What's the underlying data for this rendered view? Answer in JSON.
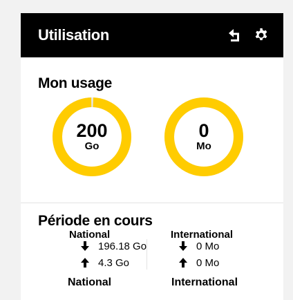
{
  "header": {
    "title": "Utilisation",
    "back_icon": "return-arrow-icon",
    "settings_icon": "gear-icon"
  },
  "usage": {
    "title": "Mon usage",
    "gauges": [
      {
        "value": "200",
        "unit": "Go",
        "label": "National",
        "fill_fraction": 0.99
      },
      {
        "value": "0",
        "unit": "Mo",
        "label": "International",
        "fill_fraction": 1.0
      }
    ]
  },
  "period": {
    "title": "Période en cours",
    "national": {
      "download": "196.18 Go",
      "upload": "4.3 Go",
      "label": "National"
    },
    "international": {
      "download": "0 Mo",
      "upload": "0 Mo",
      "label": "International"
    }
  },
  "colors": {
    "accent": "#ffcc00",
    "header_bg": "#000000",
    "background": "#f2f2f2",
    "gauge_track": "#e6e6e6"
  }
}
